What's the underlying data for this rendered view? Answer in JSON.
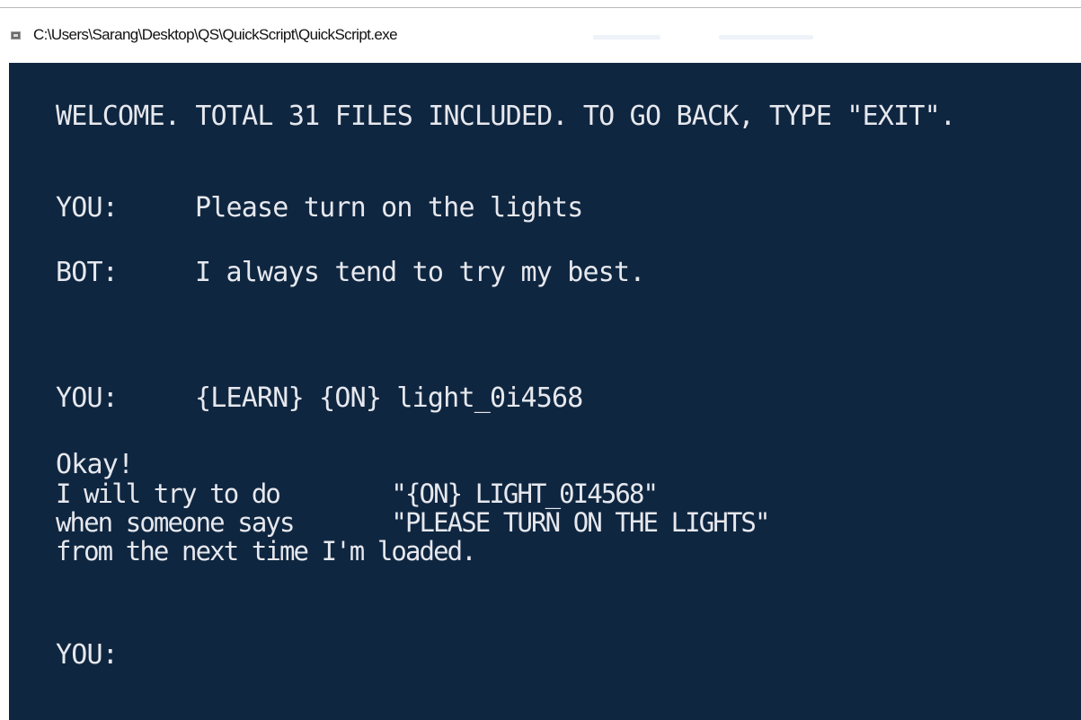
{
  "window": {
    "title": "C:\\Users\\Sarang\\Desktop\\QS\\QuickScript\\QuickScript.exe"
  },
  "console": {
    "welcome": "WELCOME. TOTAL 31 FILES INCLUDED. TO GO BACK, TYPE \"EXIT\".",
    "exchanges": [
      {
        "speaker": "YOU:",
        "text": "Please turn on the lights"
      },
      {
        "speaker": "BOT:",
        "text": "I always tend to try my best."
      },
      {
        "speaker": "YOU:",
        "text": "{LEARN} {ON} light_0i4568"
      }
    ],
    "learn_response": [
      "Okay!",
      "I will try to do        \"{ON} LIGHT_0I4568\"",
      "when someone says       \"PLEASE TURN ON THE LIGHTS\"",
      "from the next time I'm loaded."
    ],
    "current_prompt": "YOU:"
  },
  "colors": {
    "console_background": "#0f2640",
    "console_text": "#e6e8ee",
    "titlebar_background": "#ffffff"
  }
}
